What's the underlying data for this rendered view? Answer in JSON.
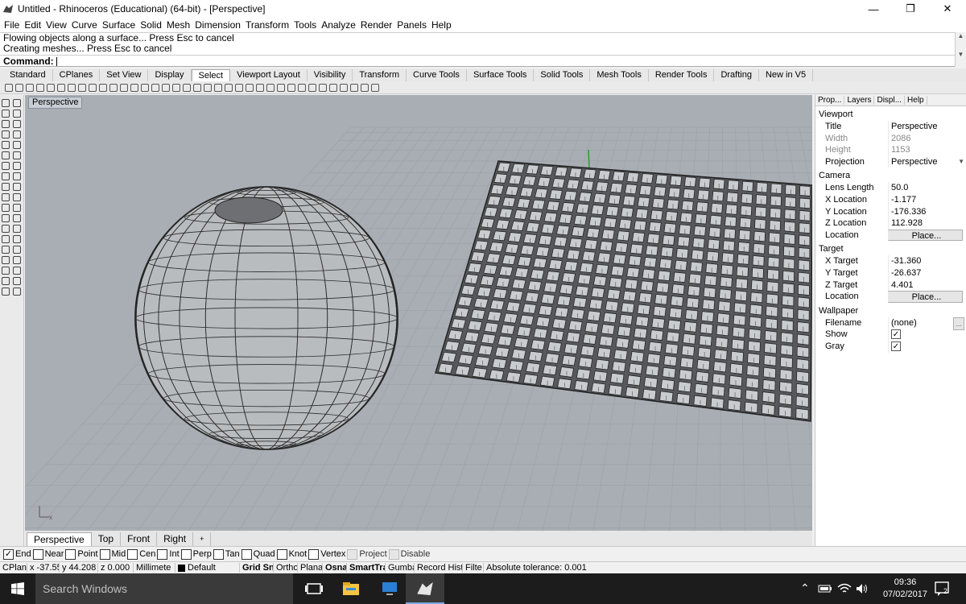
{
  "window": {
    "title": "Untitled - Rhinoceros (Educational) (64-bit) - [Perspective]",
    "minimize": "—",
    "maximize": "❐",
    "close": "✕"
  },
  "menu": [
    "File",
    "Edit",
    "View",
    "Curve",
    "Surface",
    "Solid",
    "Mesh",
    "Dimension",
    "Transform",
    "Tools",
    "Analyze",
    "Render",
    "Panels",
    "Help"
  ],
  "command": {
    "history": [
      "Flowing objects along a surface... Press Esc to cancel",
      "Creating meshes... Press Esc to cancel"
    ],
    "label": "Command:"
  },
  "toolbar_tabs": [
    "Standard",
    "CPlanes",
    "Set View",
    "Display",
    "Select",
    "Viewport Layout",
    "Visibility",
    "Transform",
    "Curve Tools",
    "Surface Tools",
    "Solid Tools",
    "Mesh Tools",
    "Render Tools",
    "Drafting",
    "New in V5"
  ],
  "active_toolbar_tab": "Select",
  "viewport": {
    "title": "Perspective",
    "axis_label": "x",
    "grid": true,
    "background_color": "#a9aeb4"
  },
  "viewport_tabs": [
    "Perspective",
    "Top",
    "Front",
    "Right",
    "+"
  ],
  "osnaps": [
    {
      "label": "End",
      "checked": true
    },
    {
      "label": "Near",
      "checked": false
    },
    {
      "label": "Point",
      "checked": false
    },
    {
      "label": "Mid",
      "checked": false
    },
    {
      "label": "Cen",
      "checked": false
    },
    {
      "label": "Int",
      "checked": false
    },
    {
      "label": "Perp",
      "checked": false
    },
    {
      "label": "Tan",
      "checked": false
    },
    {
      "label": "Quad",
      "checked": false
    },
    {
      "label": "Knot",
      "checked": false
    },
    {
      "label": "Vertex",
      "checked": false
    },
    {
      "label": "Project",
      "checked": false,
      "disabled": true
    },
    {
      "label": "Disable",
      "checked": false,
      "disabled": true
    }
  ],
  "status": {
    "cplane": "CPlane",
    "x": "x -37.55",
    "y": "y 44.208",
    "z": "z 0.000",
    "units": "Millimete",
    "layer": "Default",
    "grid_snap": "Grid Sn",
    "ortho": "Ortho",
    "planar": "Planar",
    "osnap": "Osna",
    "smarttrack": "SmartTra",
    "gumball": "Gumba",
    "record_history": "Record Hist",
    "filter": "Filte",
    "tolerance": "Absolute tolerance: 0.001"
  },
  "panel": {
    "tabs": [
      "Prop...",
      "Layers",
      "Displ...",
      "Help"
    ],
    "sections": {
      "viewport": "Viewport",
      "camera": "Camera",
      "target": "Target",
      "wallpaper": "Wallpaper"
    },
    "viewport_rows": [
      {
        "k": "Title",
        "v": "Perspective"
      },
      {
        "k": "Width",
        "v": "2086",
        "muted": true
      },
      {
        "k": "Height",
        "v": "1153",
        "muted": true
      },
      {
        "k": "Projection",
        "v": "Perspective",
        "dropdown": true
      }
    ],
    "camera_rows": [
      {
        "k": "Lens Length",
        "v": "50.0"
      },
      {
        "k": "X Location",
        "v": "-1.177"
      },
      {
        "k": "Y Location",
        "v": "-176.336"
      },
      {
        "k": "Z Location",
        "v": "112.928"
      },
      {
        "k": "Location",
        "v": "Place...",
        "button": true
      }
    ],
    "target_rows": [
      {
        "k": "X Target",
        "v": "-31.360"
      },
      {
        "k": "Y Target",
        "v": "-26.637"
      },
      {
        "k": "Z Target",
        "v": "4.401"
      },
      {
        "k": "Location",
        "v": "Place...",
        "button": true
      }
    ],
    "wallpaper_rows": [
      {
        "k": "Filename",
        "v": "(none)",
        "browse": "..."
      },
      {
        "k": "Show",
        "checked": true
      },
      {
        "k": "Gray",
        "checked": true
      }
    ]
  },
  "taskbar": {
    "search_placeholder": "Search Windows",
    "time": "09:36",
    "date": "07/02/2017",
    "notifications": "2"
  }
}
